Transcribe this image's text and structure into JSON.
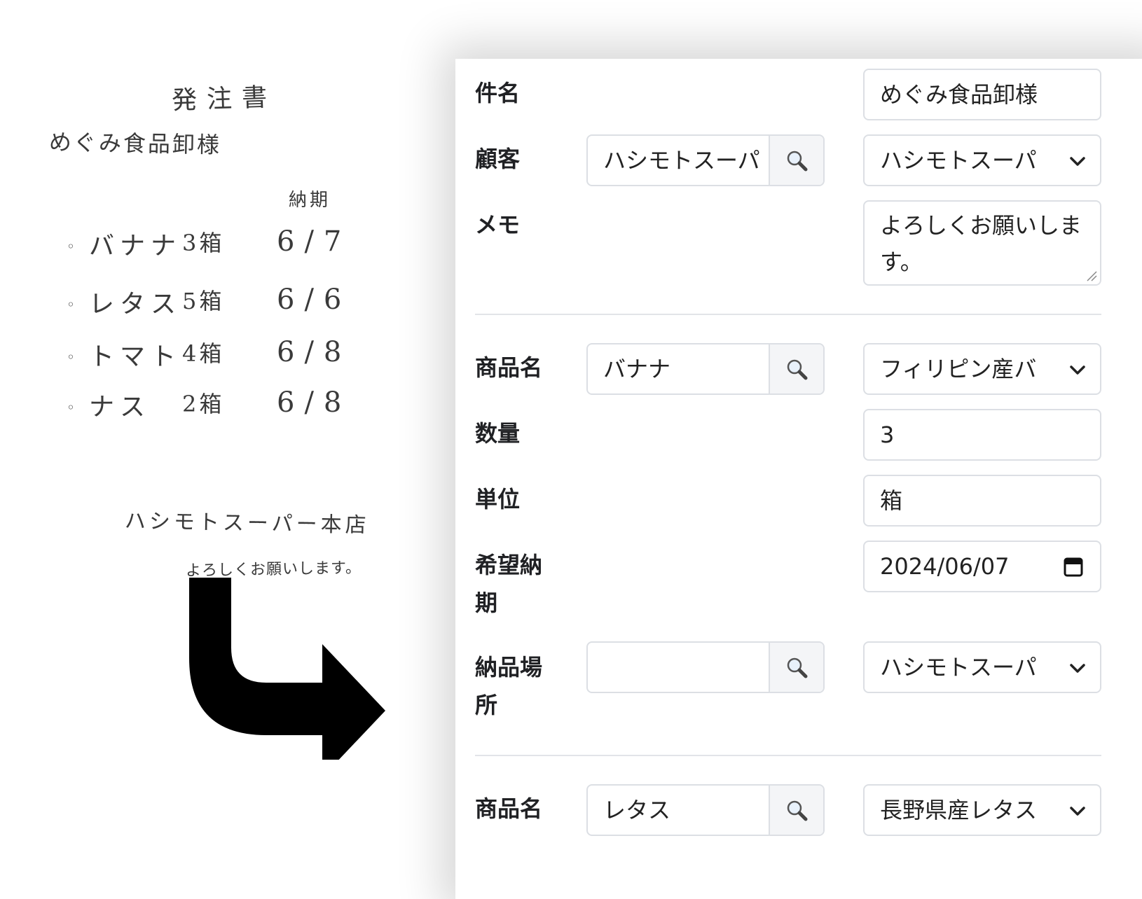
{
  "paper": {
    "title": "発注書",
    "addressee": "めぐみ食品卸様",
    "due_header": "納期",
    "rows": [
      {
        "bullet": "◦",
        "name": "バナナ",
        "qty": "3箱",
        "date": "6/7"
      },
      {
        "bullet": "◦",
        "name": "レタス",
        "qty": "5箱",
        "date": "6/6"
      },
      {
        "bullet": "◦",
        "name": "トマト",
        "qty": "4箱",
        "date": "6/8"
      },
      {
        "bullet": "◦",
        "name": "ナス",
        "qty": "2箱",
        "date": "6/8"
      }
    ],
    "store": "ハシモトスーパー本店",
    "memo": "よろしくお願いします。"
  },
  "form": {
    "subject": {
      "label": "件名",
      "value": "めぐみ食品卸様"
    },
    "customer": {
      "label": "顧客",
      "search_value": "ハシモトスーパ",
      "select_value": "ハシモトスーパ"
    },
    "memo": {
      "label": "メモ",
      "value": "よろしくお願いします。"
    },
    "item1": {
      "product_label": "商品名",
      "product_search": "バナナ",
      "product_select": "フィリピン産バ",
      "qty_label": "数量",
      "qty_value": "3",
      "unit_label": "単位",
      "unit_value": "箱",
      "due_label": "希望納期",
      "due_value": "2024/06/07",
      "place_label": "納品場所",
      "place_search": "",
      "place_select": "ハシモトスーパ"
    },
    "item2": {
      "product_label": "商品名",
      "product_search": "レタス",
      "product_select": "長野県産レタス"
    }
  },
  "icons": {
    "search": "magnifier-icon",
    "dropdown": "chevron-down-icon",
    "calendar": "calendar-icon",
    "arrow": "curved-arrow-icon"
  }
}
